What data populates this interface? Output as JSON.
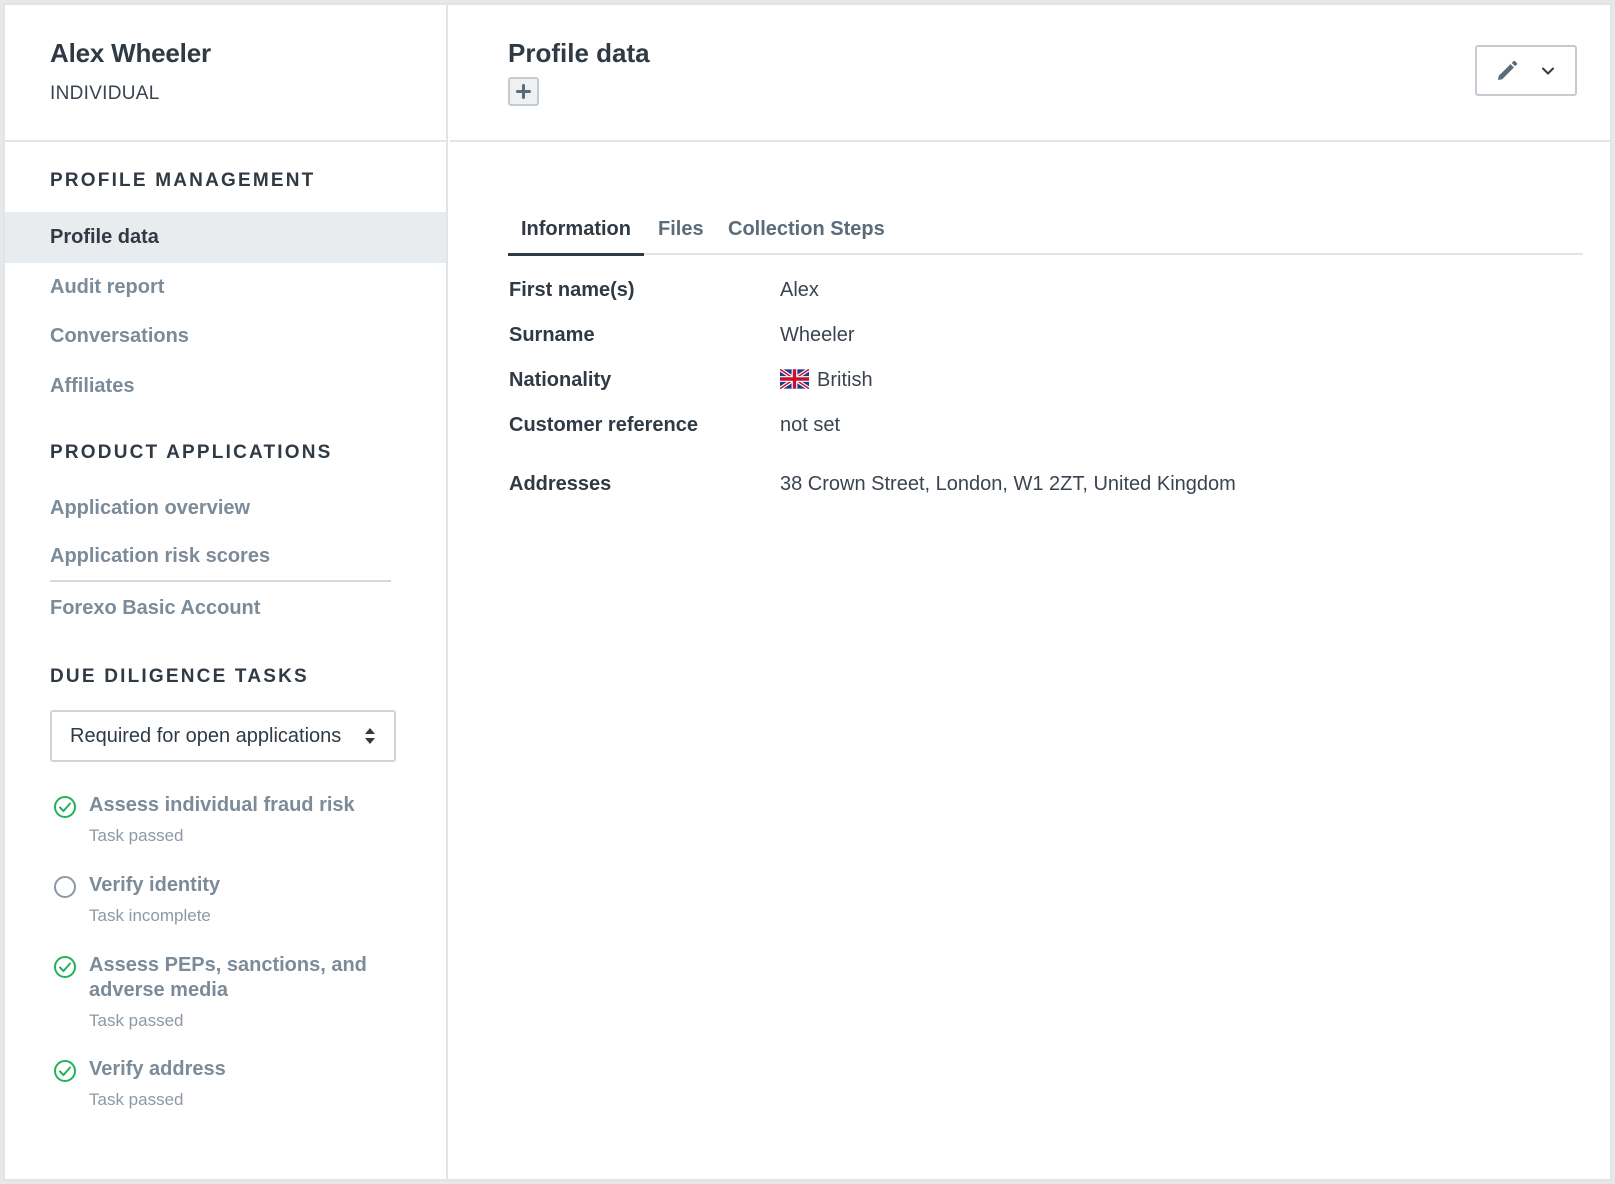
{
  "entity": {
    "name": "Alex Wheeler",
    "type": "INDIVIDUAL"
  },
  "sidebar": {
    "profile_management": {
      "title": "PROFILE MANAGEMENT",
      "items": [
        {
          "label": "Profile data",
          "active": true
        },
        {
          "label": "Audit report"
        },
        {
          "label": "Conversations"
        },
        {
          "label": "Affiliates"
        }
      ]
    },
    "product_applications": {
      "title": "PRODUCT APPLICATIONS",
      "items": [
        {
          "label": "Application overview"
        },
        {
          "label": "Application risk scores"
        },
        {
          "label": "Forexo Basic Account"
        }
      ]
    },
    "due_diligence": {
      "title": "DUE DILIGENCE TASKS",
      "filter_value": "Required for open applications",
      "tasks": [
        {
          "title": "Assess individual fraud risk",
          "status": "Task passed",
          "state": "passed"
        },
        {
          "title": "Verify identity",
          "status": "Task incomplete",
          "state": "incomplete"
        },
        {
          "title": "Assess PEPs, sanctions, and adverse media",
          "status": "Task passed",
          "state": "passed"
        },
        {
          "title": "Verify address",
          "status": "Task passed",
          "state": "passed"
        }
      ]
    }
  },
  "main": {
    "title": "Profile data",
    "tabs": [
      {
        "label": "Information",
        "active": true
      },
      {
        "label": "Files"
      },
      {
        "label": "Collection Steps"
      }
    ],
    "fields": [
      {
        "label": "First name(s)",
        "value": "Alex"
      },
      {
        "label": "Surname",
        "value": "Wheeler"
      },
      {
        "label": "Nationality",
        "value": "British",
        "icon": "uk-flag-icon"
      },
      {
        "label": "Customer reference",
        "value": "not set"
      },
      {
        "label": "Addresses",
        "value": "38 Crown Street, London, W1 2ZT, United Kingdom"
      }
    ]
  },
  "colors": {
    "success": "#21b35a",
    "muted_text": "#7c8b99",
    "active_bg": "#e9ecef",
    "border": "#e2e5e8"
  }
}
